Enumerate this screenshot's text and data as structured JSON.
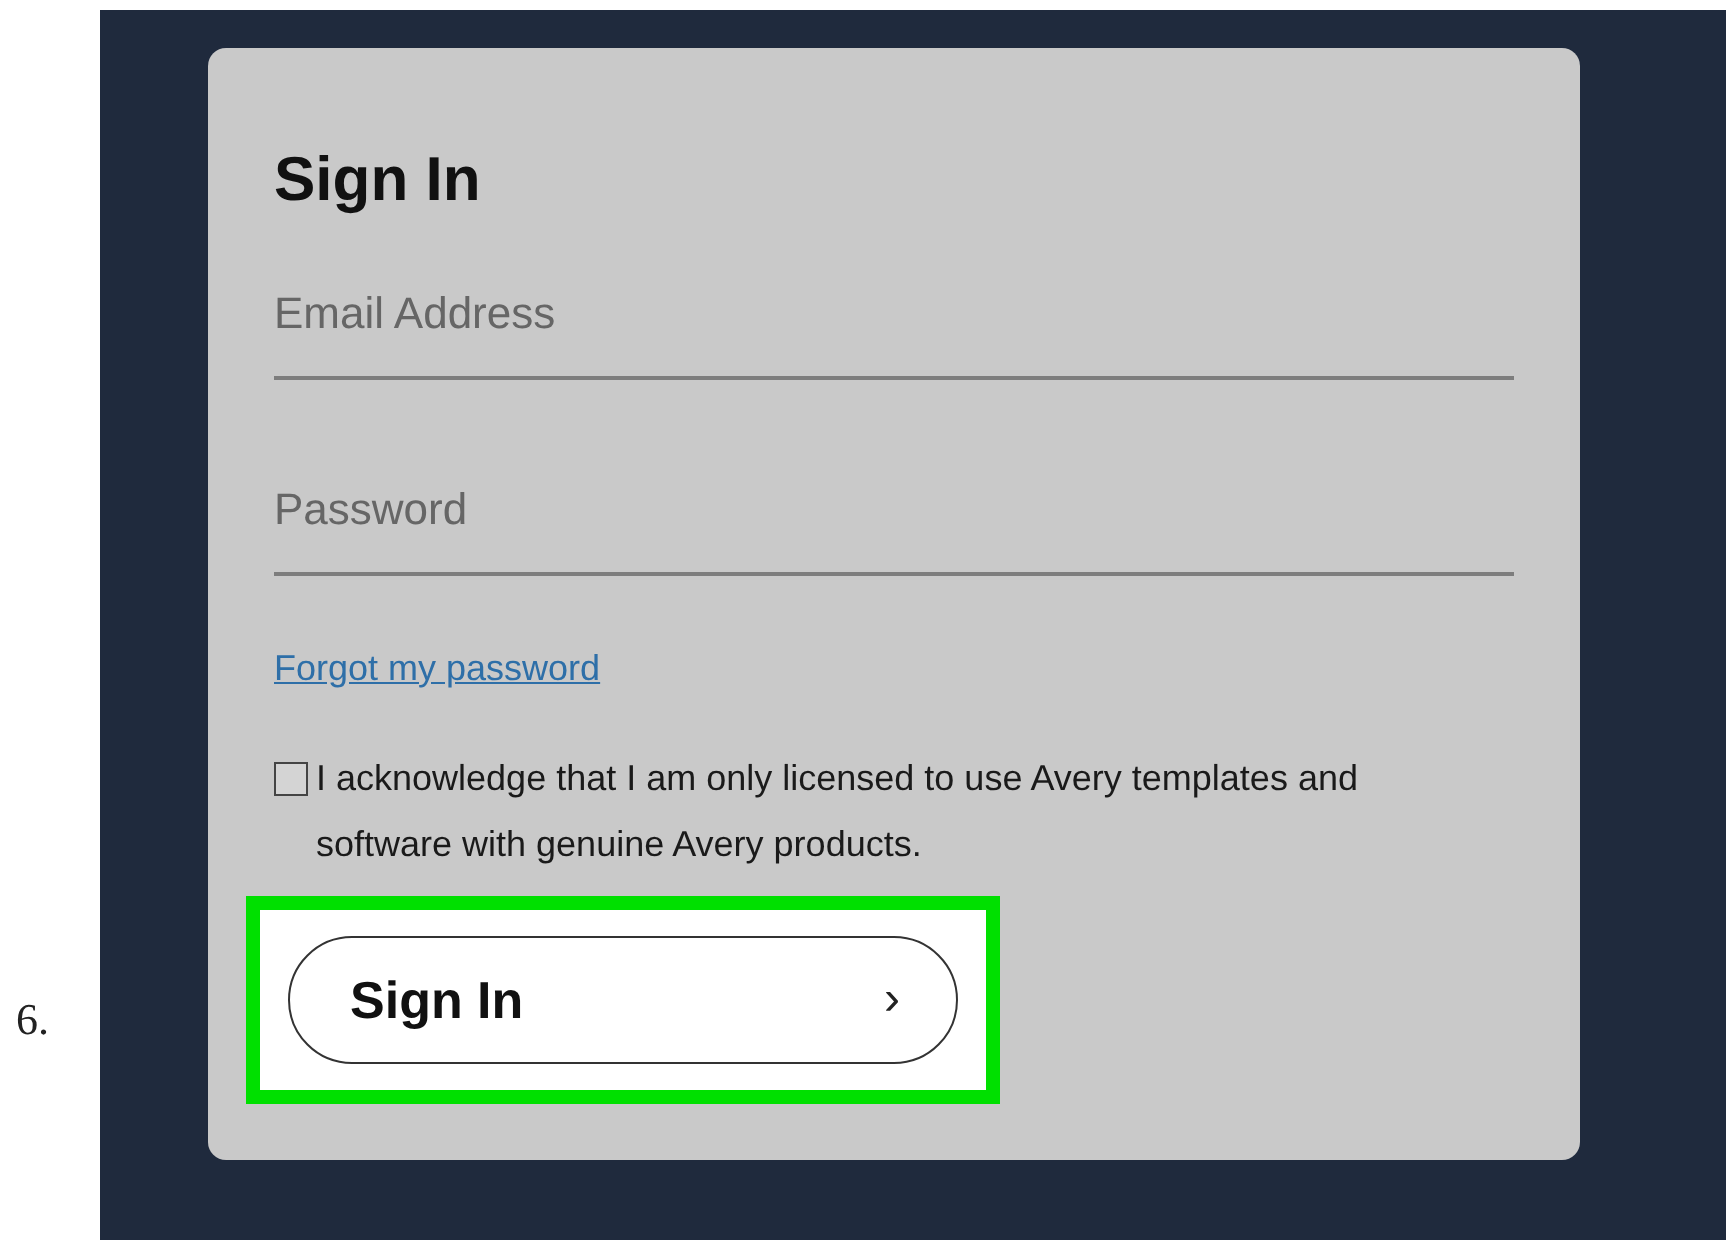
{
  "step_number": "6.",
  "form": {
    "title": "Sign In",
    "fields": [
      {
        "placeholder": "Email Address"
      },
      {
        "placeholder": "Password"
      }
    ],
    "forgot_link": "Forgot my password",
    "agreement": {
      "checked": false,
      "text": "I acknowledge that I am only licensed to use Avery templates and software with genuine Avery products."
    },
    "submit": {
      "label": "Sign In",
      "icon": "›",
      "highlighted": true
    }
  }
}
